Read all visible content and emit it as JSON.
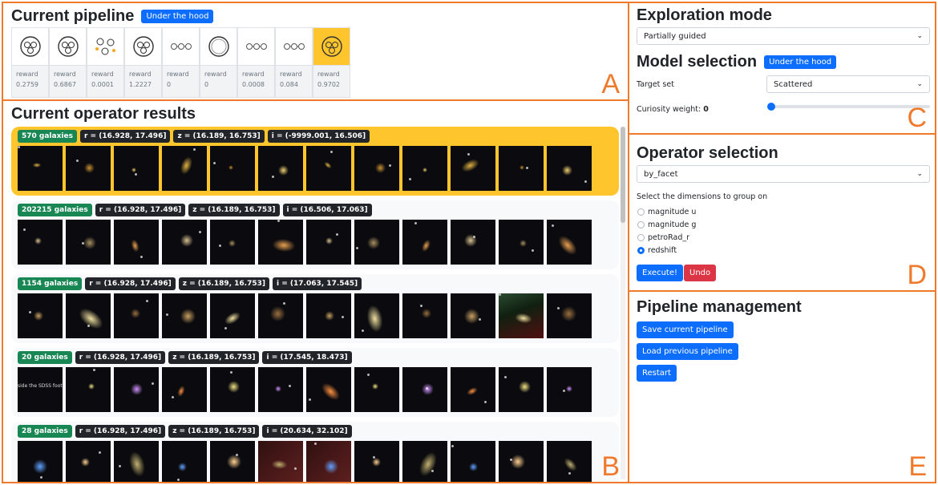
{
  "panel_a": {
    "title": "Current pipeline",
    "hood_label": "Under the hood",
    "letter": "A",
    "steps": [
      {
        "icon": "cluster-circle-icon",
        "label": "reward",
        "value": "0.2759"
      },
      {
        "icon": "cluster-circle-icon",
        "label": "reward",
        "value": "0.6867"
      },
      {
        "icon": "scattered-nodes-icon",
        "label": "reward",
        "value": "0.0001"
      },
      {
        "icon": "cluster-circle-icon",
        "label": "reward",
        "value": "1.2227"
      },
      {
        "icon": "node-chain-icon",
        "label": "reward",
        "value": "0"
      },
      {
        "icon": "ring-icon",
        "label": "reward",
        "value": "0"
      },
      {
        "icon": "node-chain-icon",
        "label": "reward",
        "value": "0.0008"
      },
      {
        "icon": "node-chain-icon",
        "label": "reward",
        "value": "0.084"
      },
      {
        "icon": "cluster-circle-icon",
        "label": "reward",
        "value": "0.9702"
      }
    ]
  },
  "panel_b": {
    "title": "Current operator results",
    "letter": "B",
    "groups": [
      {
        "count": "570 galaxies",
        "r": "r = (16.928, 17.496]",
        "z": "z = (16.189, 16.753]",
        "i": "i = (-9999.001, 16.506]"
      },
      {
        "count": "202215 galaxies",
        "r": "r = (16.928, 17.496]",
        "z": "z = (16.189, 16.753]",
        "i": "i = (16.506, 17.063]"
      },
      {
        "count": "1154 galaxies",
        "r": "r = (16.928, 17.496]",
        "z": "z = (16.189, 16.753]",
        "i": "i = (17.063, 17.545]"
      },
      {
        "count": "20 galaxies",
        "r": "r = (16.928, 17.496]",
        "z": "z = (16.189, 16.753]",
        "i": "i = (17.545, 18.473]"
      },
      {
        "count": "28 galaxies",
        "r": "r = (16.928, 17.496]",
        "z": "z = (16.189, 16.753]",
        "i": "i = (20.634, 32.102]"
      }
    ],
    "thumb_text": "side the SDSS footprin"
  },
  "panel_c": {
    "exploration_title": "Exploration mode",
    "exploration_value": "Partially guided",
    "model_title": "Model selection",
    "hood_label": "Under the hood",
    "target_label": "Target set",
    "target_value": "Scattered",
    "curiosity_label": "Curiosity weight:",
    "curiosity_value": "0",
    "letter": "C"
  },
  "panel_d": {
    "title": "Operator selection",
    "operator_value": "by_facet",
    "dims_label": "Select the dimensions to group on",
    "dims": [
      {
        "label": "magnitude u",
        "checked": false
      },
      {
        "label": "magnitude g",
        "checked": false
      },
      {
        "label": "petroRad_r",
        "checked": false
      },
      {
        "label": "redshift",
        "checked": true
      }
    ],
    "execute_label": "Execute!",
    "undo_label": "Undo",
    "letter": "D"
  },
  "panel_e": {
    "title": "Pipeline management",
    "save_label": "Save current pipeline",
    "load_label": "Load previous pipeline",
    "restart_label": "Restart",
    "letter": "E"
  }
}
